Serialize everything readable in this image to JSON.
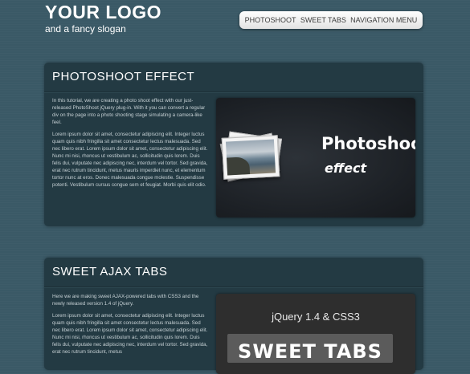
{
  "header": {
    "logo": "YOUR LOGO",
    "slogan": "and a fancy slogan"
  },
  "nav": {
    "items": [
      {
        "label": "PHOTOSHOOT"
      },
      {
        "label": "SWEET TABS"
      },
      {
        "label": "NAVIGATION MENU"
      }
    ]
  },
  "sections": [
    {
      "title": "PHOTOSHOOT EFFECT",
      "intro": "In this tutorial, we are creating a photo shoot effect with our just-released PhotoShoot jQuery plug-in. With it you can convert a regular div on the page into a photo shooting stage simulating a camera-like feel.",
      "body": "Lorem ipsum dolor sit amet, consectetur adipiscing elit. Integer luctus quam quis nibh fringilla sit amet consectetur lectus malesuada. Sed nec libero erat. Lorem ipsum dolor sit amet, consectetur adipiscing elit. Nunc mi nisi, rhoncus ut vestibulum ac, sollicitudin quis lorem. Duis felis dui, vulputate nec adipiscing nec, interdum vel tortor. Sed gravida, erat nec rutrum tincidunt, metus mauris imperdiet nunc, et elementum tortor nunc at eros. Donec malesuada congue molestie. Suspendisse potenti. Vestibulum cursus congue sem et feugiat. Morbi quis elit odio.",
      "image_title": "Photoshoot",
      "image_subtitle": "effect"
    },
    {
      "title": "SWEET AJAX TABS",
      "intro": "Here we are making sweet AJAX-powered tabs with CSS3 and the newly released version 1.4 of jQuery.",
      "body": "Lorem ipsum dolor sit amet, consectetur adipiscing elit. Integer luctus quam quis nibh fringilla sit amet consectetur lectus malesuada. Sed nec libero erat. Lorem ipsum dolor sit amet, consectetur adipiscing elit. Nunc mi nisi, rhoncus ut vestibulum ac, sollicitudin quis lorem. Duis felis dui, vulputate nec adipiscing nec, interdum vel tortor. Sed gravida, erat nec rutrum tincidunt, metus",
      "image_title": "jQuery 1.4 & CSS3",
      "image_banner": "SWEET TABS"
    }
  ],
  "colors": {
    "background": "#3a5966",
    "panel": "#233a43",
    "nav_background": "#ffffff",
    "nav_text": "#3c3c3c",
    "body_text": "#c6d0d4"
  }
}
